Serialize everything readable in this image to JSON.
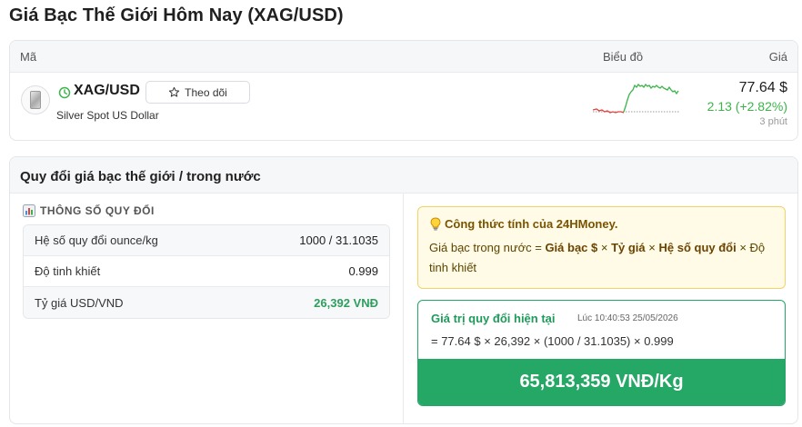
{
  "page": {
    "title": "Giá Bạc Thế Giới Hôm Nay (XAG/USD)"
  },
  "quote": {
    "headers": {
      "code": "Mã",
      "chart": "Biểu đồ",
      "price": "Giá"
    },
    "symbol": "XAG/USD",
    "name": "Silver Spot US Dollar",
    "follow_label": "Theo dõi",
    "price": "77.64 $",
    "change": "2.13 (+2.82%)",
    "updated": "3 phút",
    "colors": {
      "up": "#3bb44a",
      "down": "#e0443e"
    }
  },
  "conversion": {
    "title": "Quy đổi giá bạc thế giới / trong nước",
    "params_title": "THÔNG SỐ QUY ĐỔI",
    "params": [
      {
        "label": "Hệ số quy đổi ounce/kg",
        "value": "1000 / 31.1035"
      },
      {
        "label": "Độ tinh khiết",
        "value": "0.999"
      },
      {
        "label": "Tỷ giá USD/VND",
        "value": "26,392 VNĐ"
      }
    ],
    "formula": {
      "title": "Công thức tính của 24HMoney.",
      "prefix": "Giá bạc trong nước = ",
      "term1": "Giá bạc $",
      "op1": " × ",
      "term2": "Tỷ giá",
      "op2": " × ",
      "term3": "Hệ số quy đổi",
      "suffix": " × Độ tinh khiết"
    },
    "current": {
      "title": "Giá trị quy đổi hiện tại",
      "time": "Lúc 10:40:53 25/05/2026",
      "formula": "= 77.64 $ × 26,392 × (1000 / 31.1035) × 0.999",
      "result": "65,813,359 VNĐ/Kg"
    }
  }
}
